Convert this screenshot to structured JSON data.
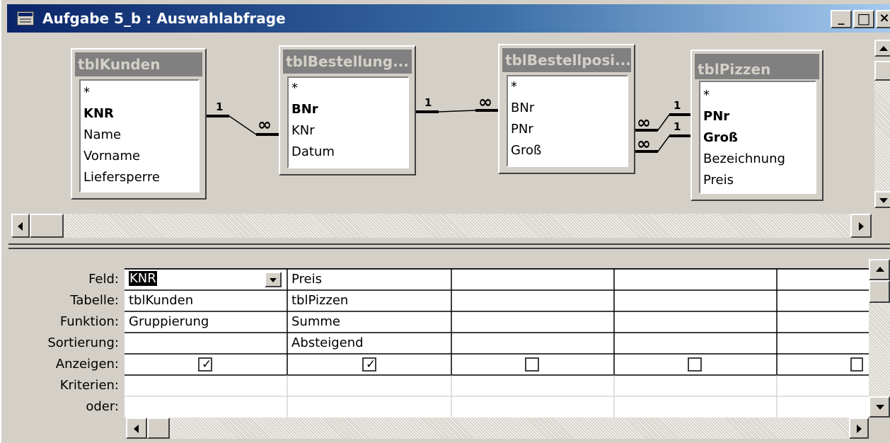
{
  "window": {
    "title": "Aufgabe 5_b : Auswahlabfrage",
    "buttons": {
      "minimize": "_",
      "maximize": "□",
      "close": "×"
    }
  },
  "tables": [
    {
      "name": "tblKunden",
      "fields": [
        {
          "name": "*",
          "key": false
        },
        {
          "name": "KNR",
          "key": true
        },
        {
          "name": "Name",
          "key": false
        },
        {
          "name": "Vorname",
          "key": false
        },
        {
          "name": "Liefersperre",
          "key": false
        }
      ]
    },
    {
      "name": "tblBestellung...",
      "fields": [
        {
          "name": "*",
          "key": false
        },
        {
          "name": "BNr",
          "key": true
        },
        {
          "name": "KNr",
          "key": false
        },
        {
          "name": "Datum",
          "key": false
        }
      ]
    },
    {
      "name": "tblBestellposi...",
      "fields": [
        {
          "name": "*",
          "key": false
        },
        {
          "name": "BNr",
          "key": false
        },
        {
          "name": "PNr",
          "key": false
        },
        {
          "name": "Groß",
          "key": false
        }
      ]
    },
    {
      "name": "tblPizzen",
      "fields": [
        {
          "name": "*",
          "key": false
        },
        {
          "name": "PNr",
          "key": true
        },
        {
          "name": "Groß",
          "key": true
        },
        {
          "name": "Bezeichnung",
          "key": false
        },
        {
          "name": "Preis",
          "key": false
        }
      ]
    }
  ],
  "relations": {
    "one": "1",
    "many": "∞"
  },
  "grid": {
    "row_labels": [
      "Feld:",
      "Tabelle:",
      "Funktion:",
      "Sortierung:",
      "Anzeigen:",
      "Kriterien:",
      "oder:"
    ],
    "columns": [
      {
        "feld": "KNR",
        "tabelle": "tblKunden",
        "funktion": "Gruppierung",
        "sortierung": "",
        "anzeigen": true
      },
      {
        "feld": "Preis",
        "tabelle": "tblPizzen",
        "funktion": "Summe",
        "sortierung": "Absteigend",
        "anzeigen": true
      },
      {
        "feld": "",
        "tabelle": "",
        "funktion": "",
        "sortierung": "",
        "anzeigen": false
      },
      {
        "feld": "",
        "tabelle": "",
        "funktion": "",
        "sortierung": "",
        "anzeigen": false
      },
      {
        "feld": "",
        "tabelle": "",
        "funktion": "",
        "sortierung": "",
        "anzeigen": false
      }
    ]
  },
  "colors": {
    "title_start": "#0a246a",
    "title_end": "#a6caf0",
    "face": "#d4d0c8",
    "header_inactive": "#808080"
  }
}
